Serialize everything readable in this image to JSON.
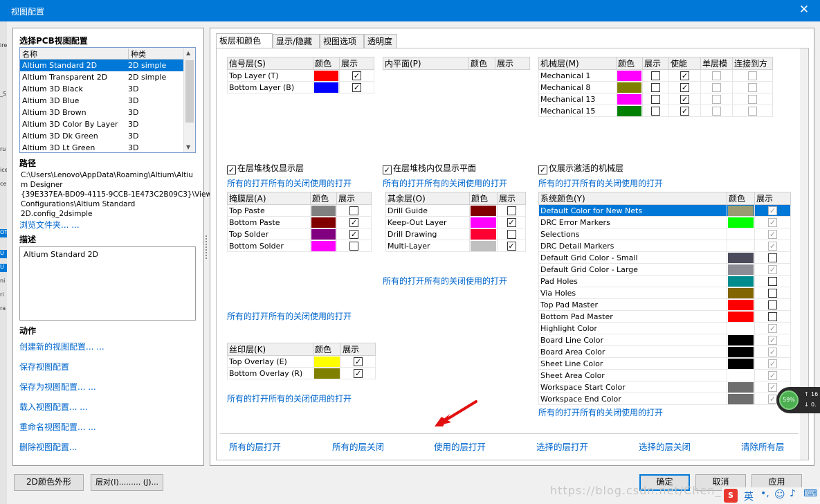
{
  "window": {
    "title": "视图配置",
    "close": "✕"
  },
  "left": {
    "select_title": "选择PCB视图配置",
    "list_headers": [
      "名称",
      "种类"
    ],
    "configs": [
      {
        "name": "Altium Standard 2D",
        "kind": "2D simple"
      },
      {
        "name": "Altium Transparent 2D",
        "kind": "2D simple"
      },
      {
        "name": "Altium 3D Black",
        "kind": "3D"
      },
      {
        "name": "Altium 3D Blue",
        "kind": "3D"
      },
      {
        "name": "Altium 3D Brown",
        "kind": "3D"
      },
      {
        "name": "Altium 3D Color By Layer",
        "kind": "3D"
      },
      {
        "name": "Altium 3D Dk Green",
        "kind": "3D"
      },
      {
        "name": "Altium 3D Lt Green",
        "kind": "3D"
      }
    ],
    "path_title": "路径",
    "path_lines": [
      "C:\\Users\\Lenovo\\AppData\\Roaming\\Altium\\Altiu",
      "m Designer",
      "{39E337EA-BD09-4115-9CCB-1E473C2B09C3}\\View",
      "Configurations\\Altium Standard",
      "2D.config_2dsimple"
    ],
    "browse": "浏览文件夹... ...",
    "desc_title": "描述",
    "desc_text": "Altium Standard 2D",
    "actions_title": "动作",
    "actions": [
      "创建新的视图配置... ...",
      "保存视图配置",
      "保存为视图配置... ...",
      "载入视图配置... ...",
      "重命名视图配置... ...",
      "删除视图配置..."
    ]
  },
  "tabs": [
    "板层和颜色",
    "显示/隐藏",
    "视图选项",
    "透明度"
  ],
  "col": {
    "color": "颜色",
    "show": "展示",
    "enable": "使能",
    "single": "单层模",
    "connect": "连接到方"
  },
  "toggle_link": "所有的打开所有的关闭使用的打开",
  "signal": {
    "title": "信号层(S)",
    "rows": [
      {
        "name": "Top Layer (T)",
        "color": "#ff0000",
        "show": true
      },
      {
        "name": "Bottom Layer (B)",
        "color": "#0000ff",
        "show": true
      }
    ],
    "stack_check": "在层堆栈仅显示层"
  },
  "internal": {
    "title": "内平面(P)",
    "stack_check": "在层堆栈内仅显示平面"
  },
  "mech": {
    "title": "机械层(M)",
    "rows": [
      {
        "name": "Mechanical 1",
        "color": "#ff00ff"
      },
      {
        "name": "Mechanical 8",
        "color": "#808000"
      },
      {
        "name": "Mechanical 13",
        "color": "#ff00ff"
      },
      {
        "name": "Mechanical 15",
        "color": "#008000"
      }
    ],
    "active_check": "仅展示激活的机械层"
  },
  "mask": {
    "title": "掩膜层(A)",
    "rows": [
      {
        "name": "Top Paste",
        "color": "#808080",
        "show": false
      },
      {
        "name": "Bottom Paste",
        "color": "#800000",
        "show": true
      },
      {
        "name": "Top Solder",
        "color": "#800080",
        "show": true
      },
      {
        "name": "Bottom Solder",
        "color": "#ff00ff",
        "show": false
      }
    ]
  },
  "other": {
    "title": "其余层(O)",
    "rows": [
      {
        "name": "Drill Guide",
        "color": "#800000",
        "show": false
      },
      {
        "name": "Keep-Out Layer",
        "color": "#ff00ff",
        "show": true
      },
      {
        "name": "Drill Drawing",
        "color": "#ff0033",
        "show": false
      },
      {
        "name": "Multi-Layer",
        "color": "#c0c0c0",
        "show": true
      }
    ]
  },
  "silk": {
    "title": "丝印层(K)",
    "rows": [
      {
        "name": "Top Overlay (E)",
        "color": "#ffff00",
        "show": true
      },
      {
        "name": "Bottom Overlay (R)",
        "color": "#808000",
        "show": true
      }
    ]
  },
  "system": {
    "title": "系统颜色(Y)",
    "rows": [
      {
        "name": "Default Color for New Nets",
        "color": "#9a9a72",
        "show": true,
        "sel": true
      },
      {
        "name": "DRC Error Markers",
        "color": "#00ff00",
        "show": true
      },
      {
        "name": "Selections",
        "color": "#ffffff",
        "show": true
      },
      {
        "name": "DRC Detail Markers",
        "color": "#ffffff",
        "show": true
      },
      {
        "name": "Default Grid Color - Small",
        "color": "#4b4b5c",
        "show": false
      },
      {
        "name": "Default Grid Color - Large",
        "color": "#8c8c94",
        "show": true
      },
      {
        "name": "Pad Holes",
        "color": "#008c8c",
        "show": false
      },
      {
        "name": "Via Holes",
        "color": "#826400",
        "show": false
      },
      {
        "name": "Top Pad Master",
        "color": "#ff0000",
        "show": false
      },
      {
        "name": "Bottom Pad Master",
        "color": "#ff0000",
        "show": false
      },
      {
        "name": "Highlight Color",
        "color": "#ffffff",
        "show": true
      },
      {
        "name": "Board Line Color",
        "color": "#000000",
        "show": true
      },
      {
        "name": "Board Area Color",
        "color": "#000000",
        "show": true
      },
      {
        "name": "Sheet Line Color",
        "color": "#000000",
        "show": true
      },
      {
        "name": "Sheet Area Color",
        "color": "#ffffff",
        "show": true
      },
      {
        "name": "Workspace Start Color",
        "color": "#6e6e6e",
        "show": true
      },
      {
        "name": "Workspace End Color",
        "color": "#6e6e6e",
        "show": true
      }
    ]
  },
  "bottom_links": [
    "所有的层打开",
    "所有的层关闭",
    "使用的层打开",
    "选择的层打开",
    "选择的层关闭",
    "清除所有层"
  ],
  "buttons": {
    "color2d": "2D颜色外形",
    "layerpairs": "层对(I)......... (J)...",
    "ok": "确定",
    "cancel": "取消",
    "apply": "应用"
  },
  "widget": {
    "percent": "59%",
    "up": "16",
    "down": "0."
  },
  "watermark": "https://blog.csdn.net/Chen_Liu_",
  "ime": "英"
}
